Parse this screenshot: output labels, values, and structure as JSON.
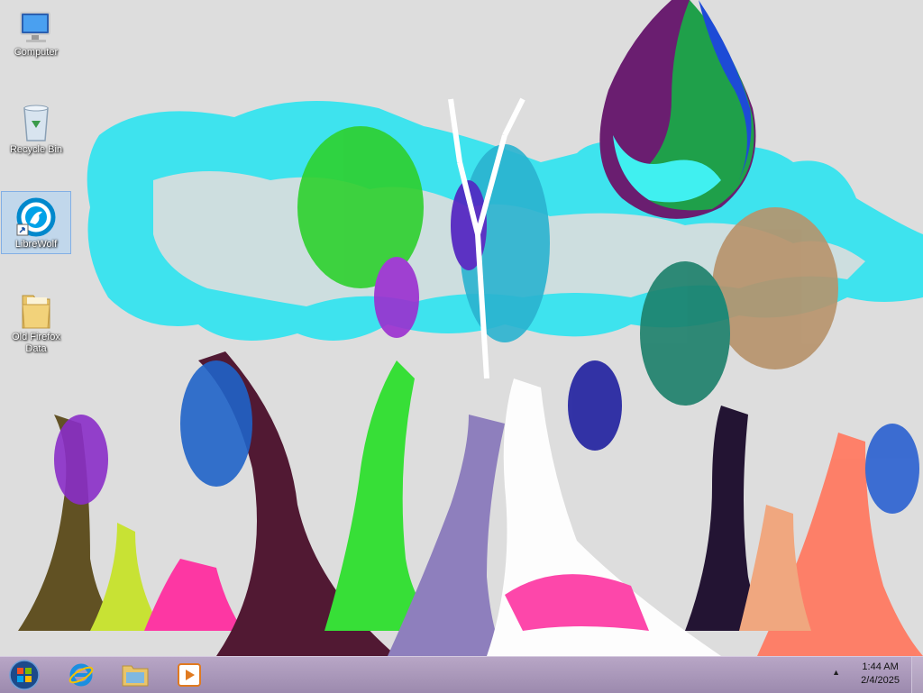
{
  "desktop": {
    "icons": [
      {
        "label": "Computer",
        "icon": "computer-icon"
      },
      {
        "label": "Recycle Bin",
        "icon": "recycle-bin-icon"
      },
      {
        "label": "LibreWolf",
        "icon": "librewolf-icon",
        "selected": true
      },
      {
        "label": "Old Firefox Data",
        "icon": "folder-icon"
      }
    ]
  },
  "taskbar": {
    "pinned": [
      {
        "icon": "start-orb-icon"
      },
      {
        "icon": "internet-explorer-icon"
      },
      {
        "icon": "file-explorer-icon"
      },
      {
        "icon": "media-player-icon"
      }
    ],
    "clock": {
      "time": "1:44 AM",
      "date": "2/4/2025"
    },
    "tray_arrow": "▲"
  },
  "colors": {
    "taskbar": "#a896b8",
    "selection": "#aad2f5"
  }
}
